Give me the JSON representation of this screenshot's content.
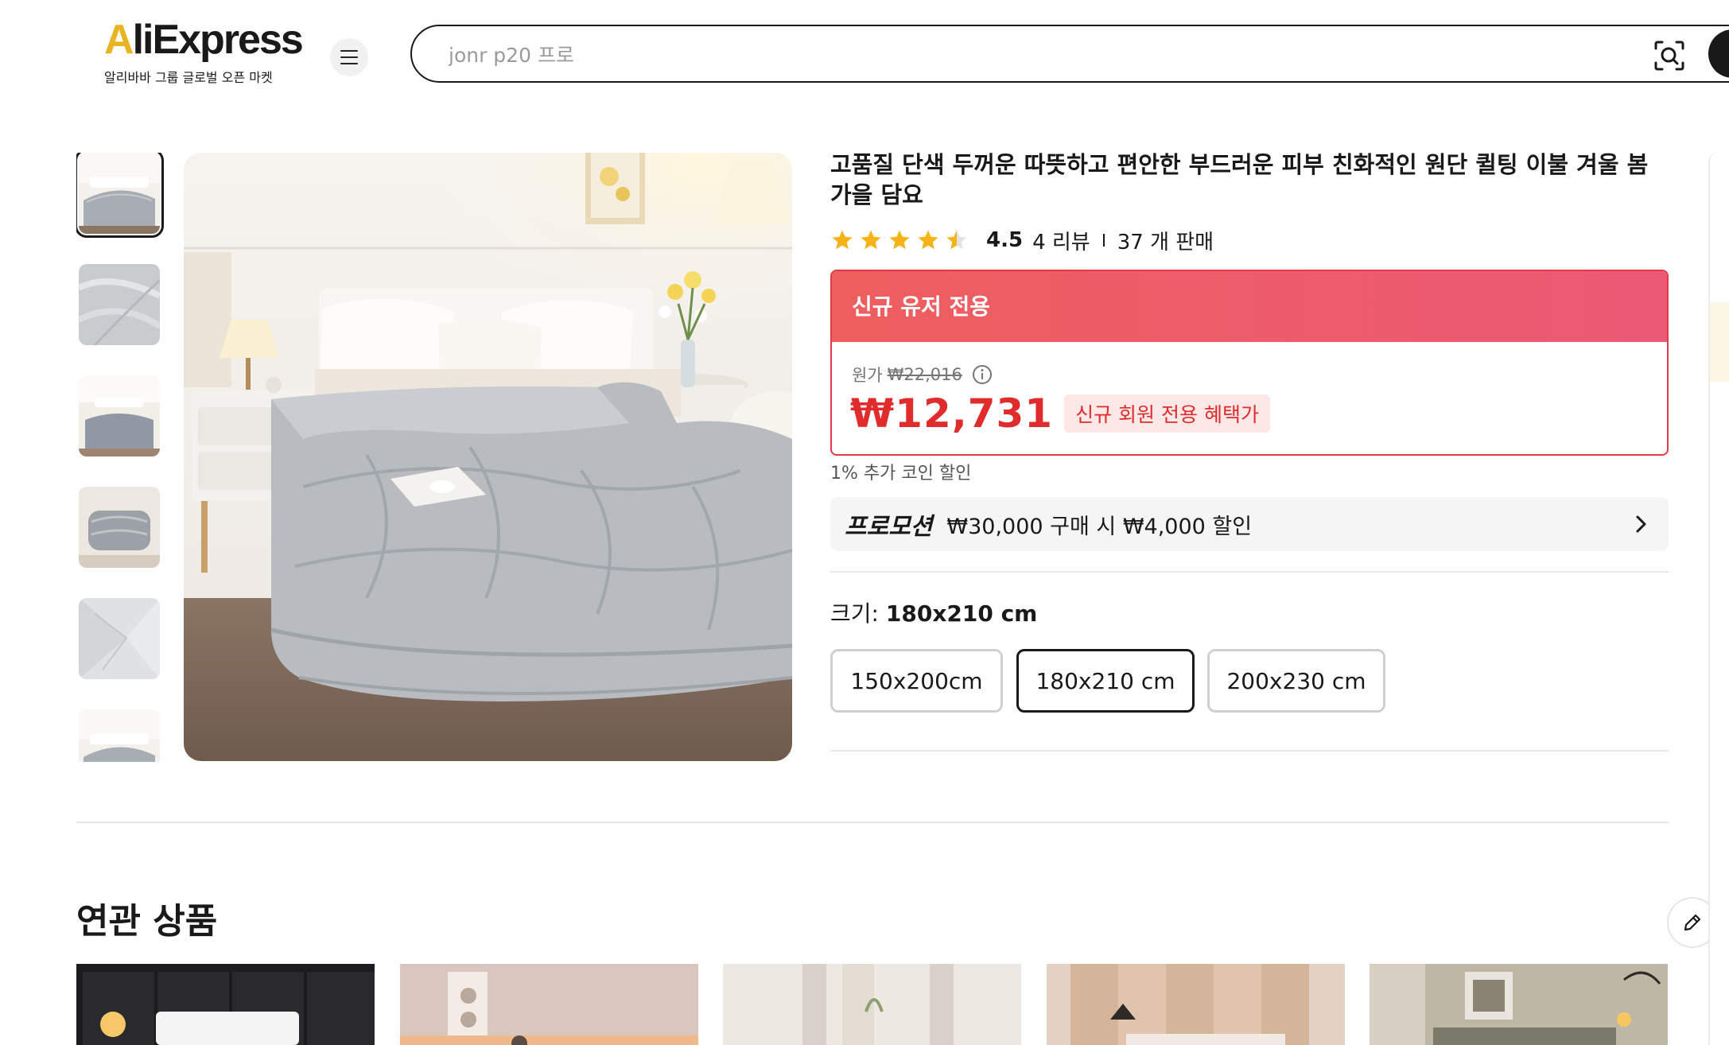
{
  "header": {
    "logo_text": "AliExpress",
    "logo_sub": "알리바바 그룹 글로벌 오픈 마켓",
    "menu_icon": "hamburger-icon",
    "search_placeholder": "jonr p20 프로",
    "camera_icon": "camera-search-icon"
  },
  "product": {
    "title": "고품질 단색 두꺼운 따뜻하고 편안한 부드러운 피부 친화적인 원단 퀼팅 이불 겨울 봄 가을 담요",
    "rating": 4.5,
    "rating_text": "4.5",
    "reviews": "4 리뷰",
    "sold": "37 개 판매",
    "price_card": {
      "header": "신규 유저 전용",
      "original_label": "원가",
      "original_price": "₩22,016",
      "price": "₩12,731",
      "price_tag": "신규 회원 전용 혜택가"
    },
    "coin_text": "1% 추가 코인 할인",
    "promotion": {
      "label": "프로모션",
      "text": "₩30,000 구매 시 ₩4,000 할인"
    },
    "size": {
      "label": "크기:",
      "selected": "180x210 cm",
      "options": [
        "150x200cm",
        "180x210 cm",
        "200x230 cm"
      ]
    }
  },
  "gallery": {
    "thumb_count": 6,
    "active_index": 0
  },
  "related": {
    "title": "연관 상품"
  },
  "colors": {
    "accent_red": "#e02c2c",
    "header_gradient_start": "#ee5e5e",
    "header_gradient_end": "#ec5976",
    "star": "#f5b316",
    "logo_accent": "#e8b422"
  }
}
